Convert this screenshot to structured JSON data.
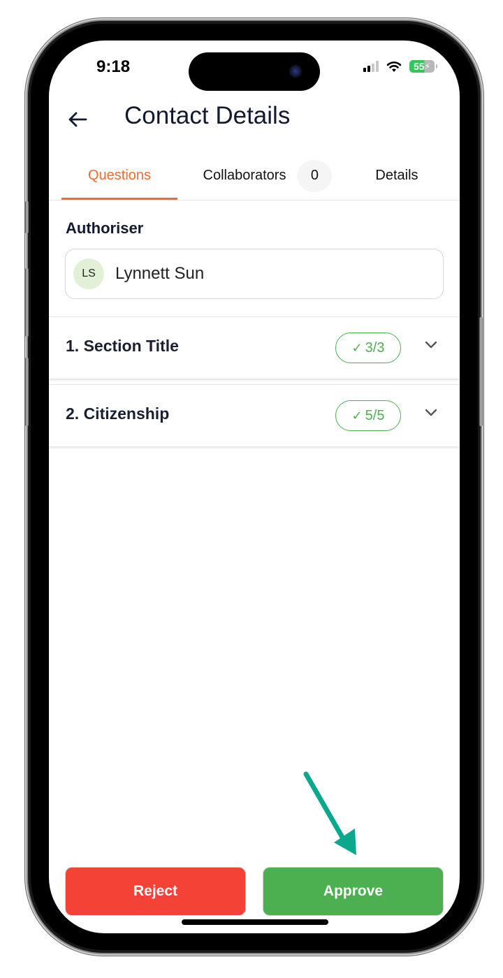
{
  "status_bar": {
    "time": "9:18",
    "battery_level": "55",
    "signal_icon": "cellular-signal-icon",
    "wifi_icon": "wifi-icon",
    "battery_icon": "battery-charging-icon"
  },
  "header": {
    "back_icon": "arrow-left-icon",
    "title": "Contact Details"
  },
  "tabs": [
    {
      "label": "Questions",
      "active": true
    },
    {
      "label": "Collaborators",
      "badge": "0",
      "active": false
    },
    {
      "label": "Details",
      "active": false
    }
  ],
  "authoriser": {
    "label": "Authoriser",
    "initials": "LS",
    "name": "Lynnett Sun"
  },
  "sections": [
    {
      "title": "1. Section Title",
      "progress": "3/3",
      "completed": 3,
      "total": 3
    },
    {
      "title": "2. Citizenship",
      "progress": "5/5",
      "completed": 5,
      "total": 5
    }
  ],
  "actions": {
    "reject_label": "Reject",
    "approve_label": "Approve"
  },
  "colors": {
    "accent": "#f26a2c",
    "title": "#111a2e",
    "success": "#4caf50",
    "danger": "#f44336",
    "annotation_arrow": "#0aa88c"
  }
}
